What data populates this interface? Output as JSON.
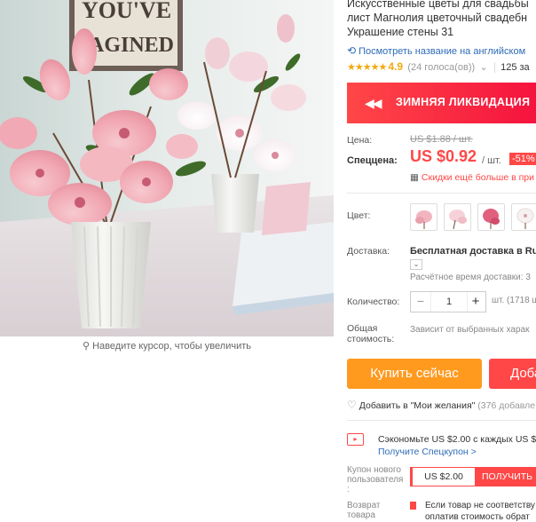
{
  "photo": {
    "sign_line1": "YOU'VE",
    "sign_line2": "AGINED",
    "zoom_hint": "Наведите курсор, чтобы увеличить"
  },
  "product": {
    "title_lines": [
      "Искусственные цветы для свадьбы",
      "лист Магнолия цветочный свадебн",
      "Украшение стены 31"
    ],
    "translate_link": "Посмотреть название на английском",
    "stars": "★★★★★",
    "rating": "4.9",
    "votes": "(24 голоса(ов))",
    "orders": "125 за"
  },
  "banner": {
    "icon": "◀◀",
    "text": "ЗИМНЯЯ ЛИКВИДАЦИЯ"
  },
  "price": {
    "label": "Цена:",
    "old": "US $1.88 / шт.",
    "sale_label": "Спеццена:",
    "new": "US $0.92",
    "per_unit": "/ шт.",
    "discount": "-51%",
    "app_promo": "Скидки ещё больше в при"
  },
  "color": {
    "label": "Цвет:"
  },
  "shipping": {
    "label": "Доставка:",
    "text": "Бесплатная доставка в Russ",
    "time": "Расчётное время доставки: 3"
  },
  "quantity": {
    "label": "Количество:",
    "value": "1",
    "minus": "−",
    "plus": "+",
    "available": "шт. (1718 ш"
  },
  "total": {
    "label_line1": "Общая",
    "label_line2": "стоимость:",
    "value": "Зависит от выбранных харак"
  },
  "actions": {
    "buy": "Купить сейчас",
    "cart": "Доба",
    "wishlist": "Добавить в \"Мои желания\"",
    "wishlist_count": "(376 добавле"
  },
  "coupon": {
    "save_text": "Сэкономьте US $2.00 с каждых US $1",
    "link": "Получите Спецкупон >",
    "new_user_label_1": "Купон нового",
    "new_user_label_2": "пользователя",
    "new_user_label_3": ":",
    "new_user_value": "US $2.00",
    "get_button": "ПОЛУЧИТЬ"
  },
  "returns": {
    "label_1": "Возврат",
    "label_2": "товара",
    "line1": "Если товар не соответству",
    "line2": "оплатив стоимость обрат"
  },
  "colors": {
    "accent": "#ff4747",
    "buy": "#ff9a1f",
    "link": "#2e6bb6",
    "star": "#f2a90f"
  }
}
